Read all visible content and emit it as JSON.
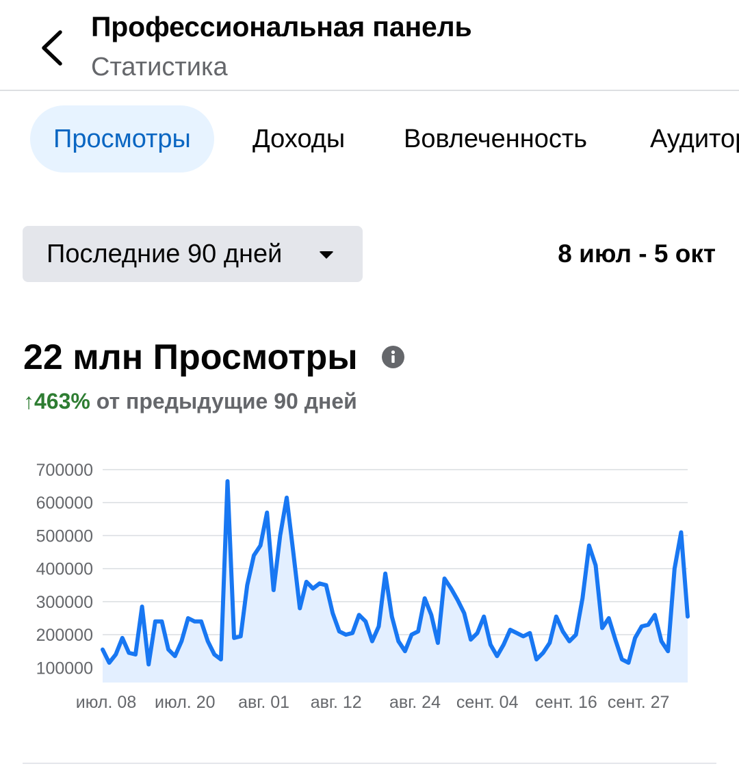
{
  "header": {
    "title": "Профессиональная панель",
    "subtitle": "Статистика",
    "back_icon": "chevron-left-icon"
  },
  "tabs": [
    {
      "label": "Просмотры",
      "active": true
    },
    {
      "label": "Доходы",
      "active": false
    },
    {
      "label": "Вовлеченность",
      "active": false
    },
    {
      "label": "Аудитория",
      "active": false
    }
  ],
  "range": {
    "selector_label": "Последние 90 дней",
    "dates": "8 июл - 5 окт"
  },
  "metric": {
    "value_label": "22 млн Просмотры",
    "change_arrow": "↑",
    "change_percent": "463%",
    "change_text": "от предыдущие 90 дней"
  },
  "colors": {
    "accent": "#0a66c2",
    "line": "#1877f2",
    "area": "#e3efff",
    "positive": "#2e7d32",
    "muted": "#65676b"
  },
  "chart_data": {
    "type": "area",
    "x": [
      "07-08",
      "07-09",
      "07-10",
      "07-11",
      "07-12",
      "07-13",
      "07-14",
      "07-15",
      "07-16",
      "07-17",
      "07-18",
      "07-19",
      "07-20",
      "07-21",
      "07-22",
      "07-23",
      "07-24",
      "07-25",
      "07-26",
      "07-27",
      "07-28",
      "07-29",
      "07-30",
      "07-31",
      "08-01",
      "08-02",
      "08-03",
      "08-04",
      "08-05",
      "08-06",
      "08-07",
      "08-08",
      "08-09",
      "08-10",
      "08-11",
      "08-12",
      "08-13",
      "08-14",
      "08-15",
      "08-16",
      "08-17",
      "08-18",
      "08-19",
      "08-20",
      "08-21",
      "08-22",
      "08-23",
      "08-24",
      "08-25",
      "08-26",
      "08-27",
      "08-28",
      "08-29",
      "08-30",
      "08-31",
      "09-01",
      "09-02",
      "09-03",
      "09-04",
      "09-05",
      "09-06",
      "09-07",
      "09-08",
      "09-09",
      "09-10",
      "09-11",
      "09-12",
      "09-13",
      "09-14",
      "09-15",
      "09-16",
      "09-17",
      "09-18",
      "09-19",
      "09-20",
      "09-21",
      "09-22",
      "09-23",
      "09-24",
      "09-25",
      "09-26",
      "09-27",
      "09-28",
      "09-29",
      "09-30",
      "10-01",
      "10-02",
      "10-03",
      "10-04",
      "10-05"
    ],
    "values": [
      155000,
      115000,
      140000,
      190000,
      145000,
      140000,
      285000,
      110000,
      240000,
      240000,
      155000,
      135000,
      180000,
      250000,
      240000,
      240000,
      180000,
      140000,
      125000,
      665000,
      190000,
      195000,
      350000,
      440000,
      470000,
      570000,
      335000,
      500000,
      615000,
      450000,
      280000,
      360000,
      340000,
      355000,
      350000,
      265000,
      210000,
      200000,
      205000,
      260000,
      240000,
      180000,
      225000,
      385000,
      255000,
      180000,
      150000,
      200000,
      210000,
      310000,
      260000,
      175000,
      370000,
      340000,
      305000,
      265000,
      185000,
      205000,
      255000,
      170000,
      135000,
      170000,
      215000,
      205000,
      195000,
      205000,
      125000,
      145000,
      175000,
      255000,
      210000,
      180000,
      200000,
      310000,
      470000,
      410000,
      220000,
      250000,
      185000,
      125000,
      115000,
      190000,
      225000,
      230000,
      260000,
      180000,
      150000,
      400000,
      510000,
      255000
    ],
    "x_tick_labels": [
      "июл. 08",
      "июл. 20",
      "авг. 01",
      "авг. 12",
      "авг. 24",
      "сент. 04",
      "сент. 16",
      "сент. 27"
    ],
    "x_tick_index": [
      0,
      12,
      24,
      35,
      47,
      58,
      70,
      81
    ],
    "y_ticks": [
      100000,
      200000,
      300000,
      400000,
      500000,
      600000,
      700000
    ],
    "ylim": [
      55000,
      700000
    ],
    "grid": true,
    "legend": "none"
  }
}
